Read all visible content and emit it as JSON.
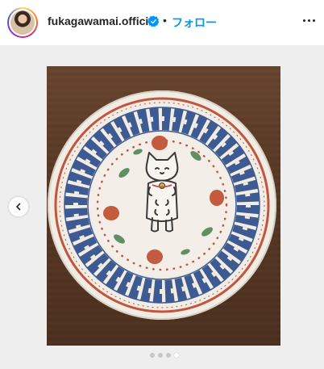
{
  "header": {
    "username": "fukagawamai.official",
    "separator": "•",
    "follow_label": "フォロー",
    "verified_icon": "verified-badge-icon",
    "more_icon": "more-options-icon"
  },
  "carousel": {
    "image_count": 4,
    "active_index": 3,
    "prev_icon": "chevron-left-icon"
  },
  "colors": {
    "follow_blue": "#0095f6",
    "verified_blue": "#0095f6",
    "text": "#262626",
    "background": "#eeeeee"
  }
}
